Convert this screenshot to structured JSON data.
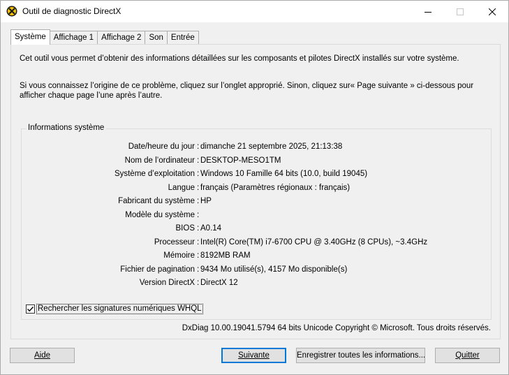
{
  "window": {
    "title": "Outil de diagnostic DirectX"
  },
  "tabs": [
    {
      "label": "Système",
      "active": true
    },
    {
      "label": "Affichage 1",
      "active": false
    },
    {
      "label": "Affichage 2",
      "active": false
    },
    {
      "label": "Son",
      "active": false
    },
    {
      "label": "Entrée",
      "active": false
    }
  ],
  "intro": {
    "line1": "Cet outil vous permet d’obtenir des informations détaillées sur les composants et pilotes DirectX installés sur votre système.",
    "line2": "Si vous connaissez l’origine de ce problème, cliquez sur l’onglet approprié. Sinon, cliquez sur« Page suivante » ci-dessous pour afficher chaque page l’une après l’autre."
  },
  "system_info": {
    "group_title": "Informations système",
    "rows": [
      {
        "label": "Date/heure du jour",
        "value": "dimanche 21 septembre 2025, 21:13:38"
      },
      {
        "label": "Nom de l’ordinateur",
        "value": "DESKTOP-MESO1TM"
      },
      {
        "label": "Système d’exploitation",
        "value": "Windows 10 Famille 64 bits (10.0, build 19045)"
      },
      {
        "label": "Langue",
        "value": "français (Paramètres régionaux : français)"
      },
      {
        "label": "Fabricant du système",
        "value": "HP"
      },
      {
        "label": "Modèle du système",
        "value": ""
      },
      {
        "label": "BIOS",
        "value": "A0.14"
      },
      {
        "label": "Processeur",
        "value": "Intel(R) Core(TM) i7-6700 CPU @ 3.40GHz (8 CPUs), ~3.4GHz"
      },
      {
        "label": "Mémoire",
        "value": "8192MB RAM"
      },
      {
        "label": "Fichier de pagination",
        "value": "9434 Mo utilisé(s), 4157 Mo disponible(s)"
      },
      {
        "label": "Version DirectX",
        "value": "DirectX 12"
      }
    ],
    "colon": ":",
    "whql_checkbox": {
      "label": "Rechercher les signatures numériques WHQL",
      "checked": true
    }
  },
  "copyright": "DxDiag 10.00.19041.5794 64 bits Unicode Copyright © Microsoft. Tous droits réservés.",
  "buttons": {
    "help": "Aide",
    "next": "Suivante",
    "save": "Enregistrer toutes les informations...",
    "quit": "Quitter"
  }
}
